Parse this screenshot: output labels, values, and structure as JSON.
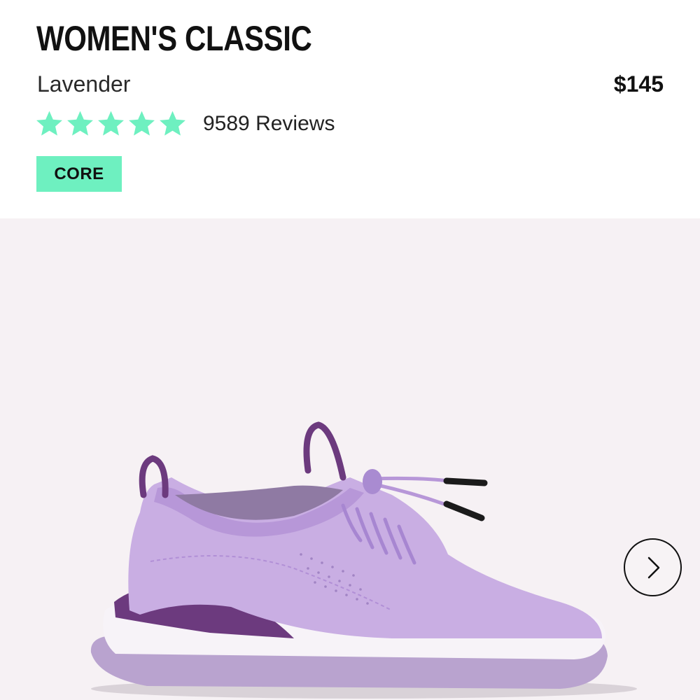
{
  "product": {
    "title": "WOMEN'S CLASSIC",
    "color": "Lavender",
    "price": "$145",
    "rating": 5,
    "rating_max": 5,
    "reviews_text": "9589 Reviews",
    "badge": "CORE"
  },
  "colors": {
    "accent": "#6ef0c0",
    "star": "#6ef0c0",
    "image_background": "#f6f1f4",
    "shoe_upper": "#c9aee3",
    "shoe_accent": "#6c3a7e"
  },
  "icons": {
    "star": "star-icon",
    "next": "chevron-right-icon"
  }
}
